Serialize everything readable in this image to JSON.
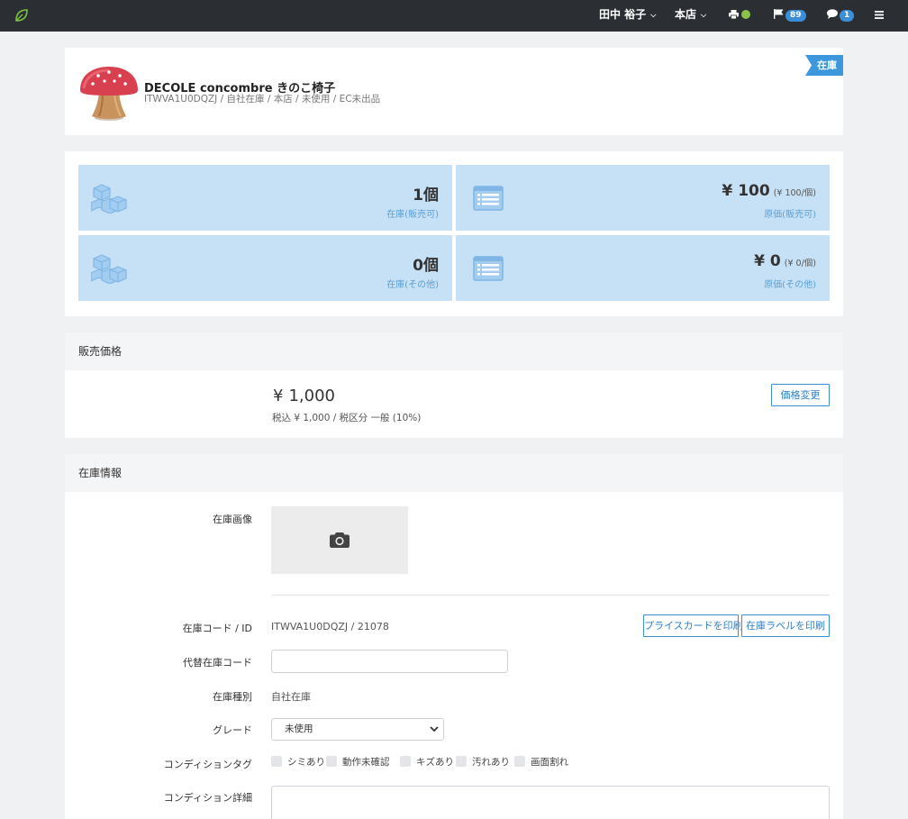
{
  "topbar": {
    "logo_icon": "leaf-icon",
    "user_name": "田中 裕子",
    "store_name": "本店",
    "notification_count": "89",
    "message_count": "1",
    "status_color": "#8bc34a"
  },
  "product": {
    "name": "DECOLE concombre きのこ椅子",
    "subtitle": "ITWVA1U0DQZJ / 自社在庫 / 本店 / 未使用 / EC未出品",
    "ribbon": "在庫"
  },
  "stats": {
    "stock_available_value": "1個",
    "stock_available_label": "在庫(販売可)",
    "cost_available_yen": "¥",
    "cost_available_value": "100",
    "cost_available_unit": "(¥ 100/個)",
    "cost_available_label": "原価(販売可)",
    "stock_other_value": "0個",
    "stock_other_label": "在庫(その他)",
    "cost_other_yen": "¥",
    "cost_other_value": "0",
    "cost_other_unit": "(¥ 0/個)",
    "cost_other_label": "原価(その他)"
  },
  "price": {
    "heading": "販売価格",
    "yen": "¥",
    "amount": "1,000",
    "detail": "税込 ¥ 1,000 / 税区分 一般 (10%)",
    "change_button": "価格変更"
  },
  "inventory": {
    "heading": "在庫情報",
    "image_label": "在庫画像",
    "code_label": "在庫コード / ID",
    "code_value": "ITWVA1U0DQZJ / 21078",
    "print_price_card": "プライスカードを印刷",
    "print_stock_label": "在庫ラベルを印刷",
    "alt_code_label": "代替在庫コード",
    "alt_code_value": "",
    "type_label": "在庫種別",
    "type_value": "自社在庫",
    "grade_label": "グレード",
    "grade_value": "未使用",
    "condition_tag_label": "コンディションタグ",
    "condition_tags": [
      "シミあり",
      "動作未確認",
      "キズあり",
      "汚れあり",
      "画面割れ"
    ],
    "condition_detail_label": "コンディション詳細"
  }
}
